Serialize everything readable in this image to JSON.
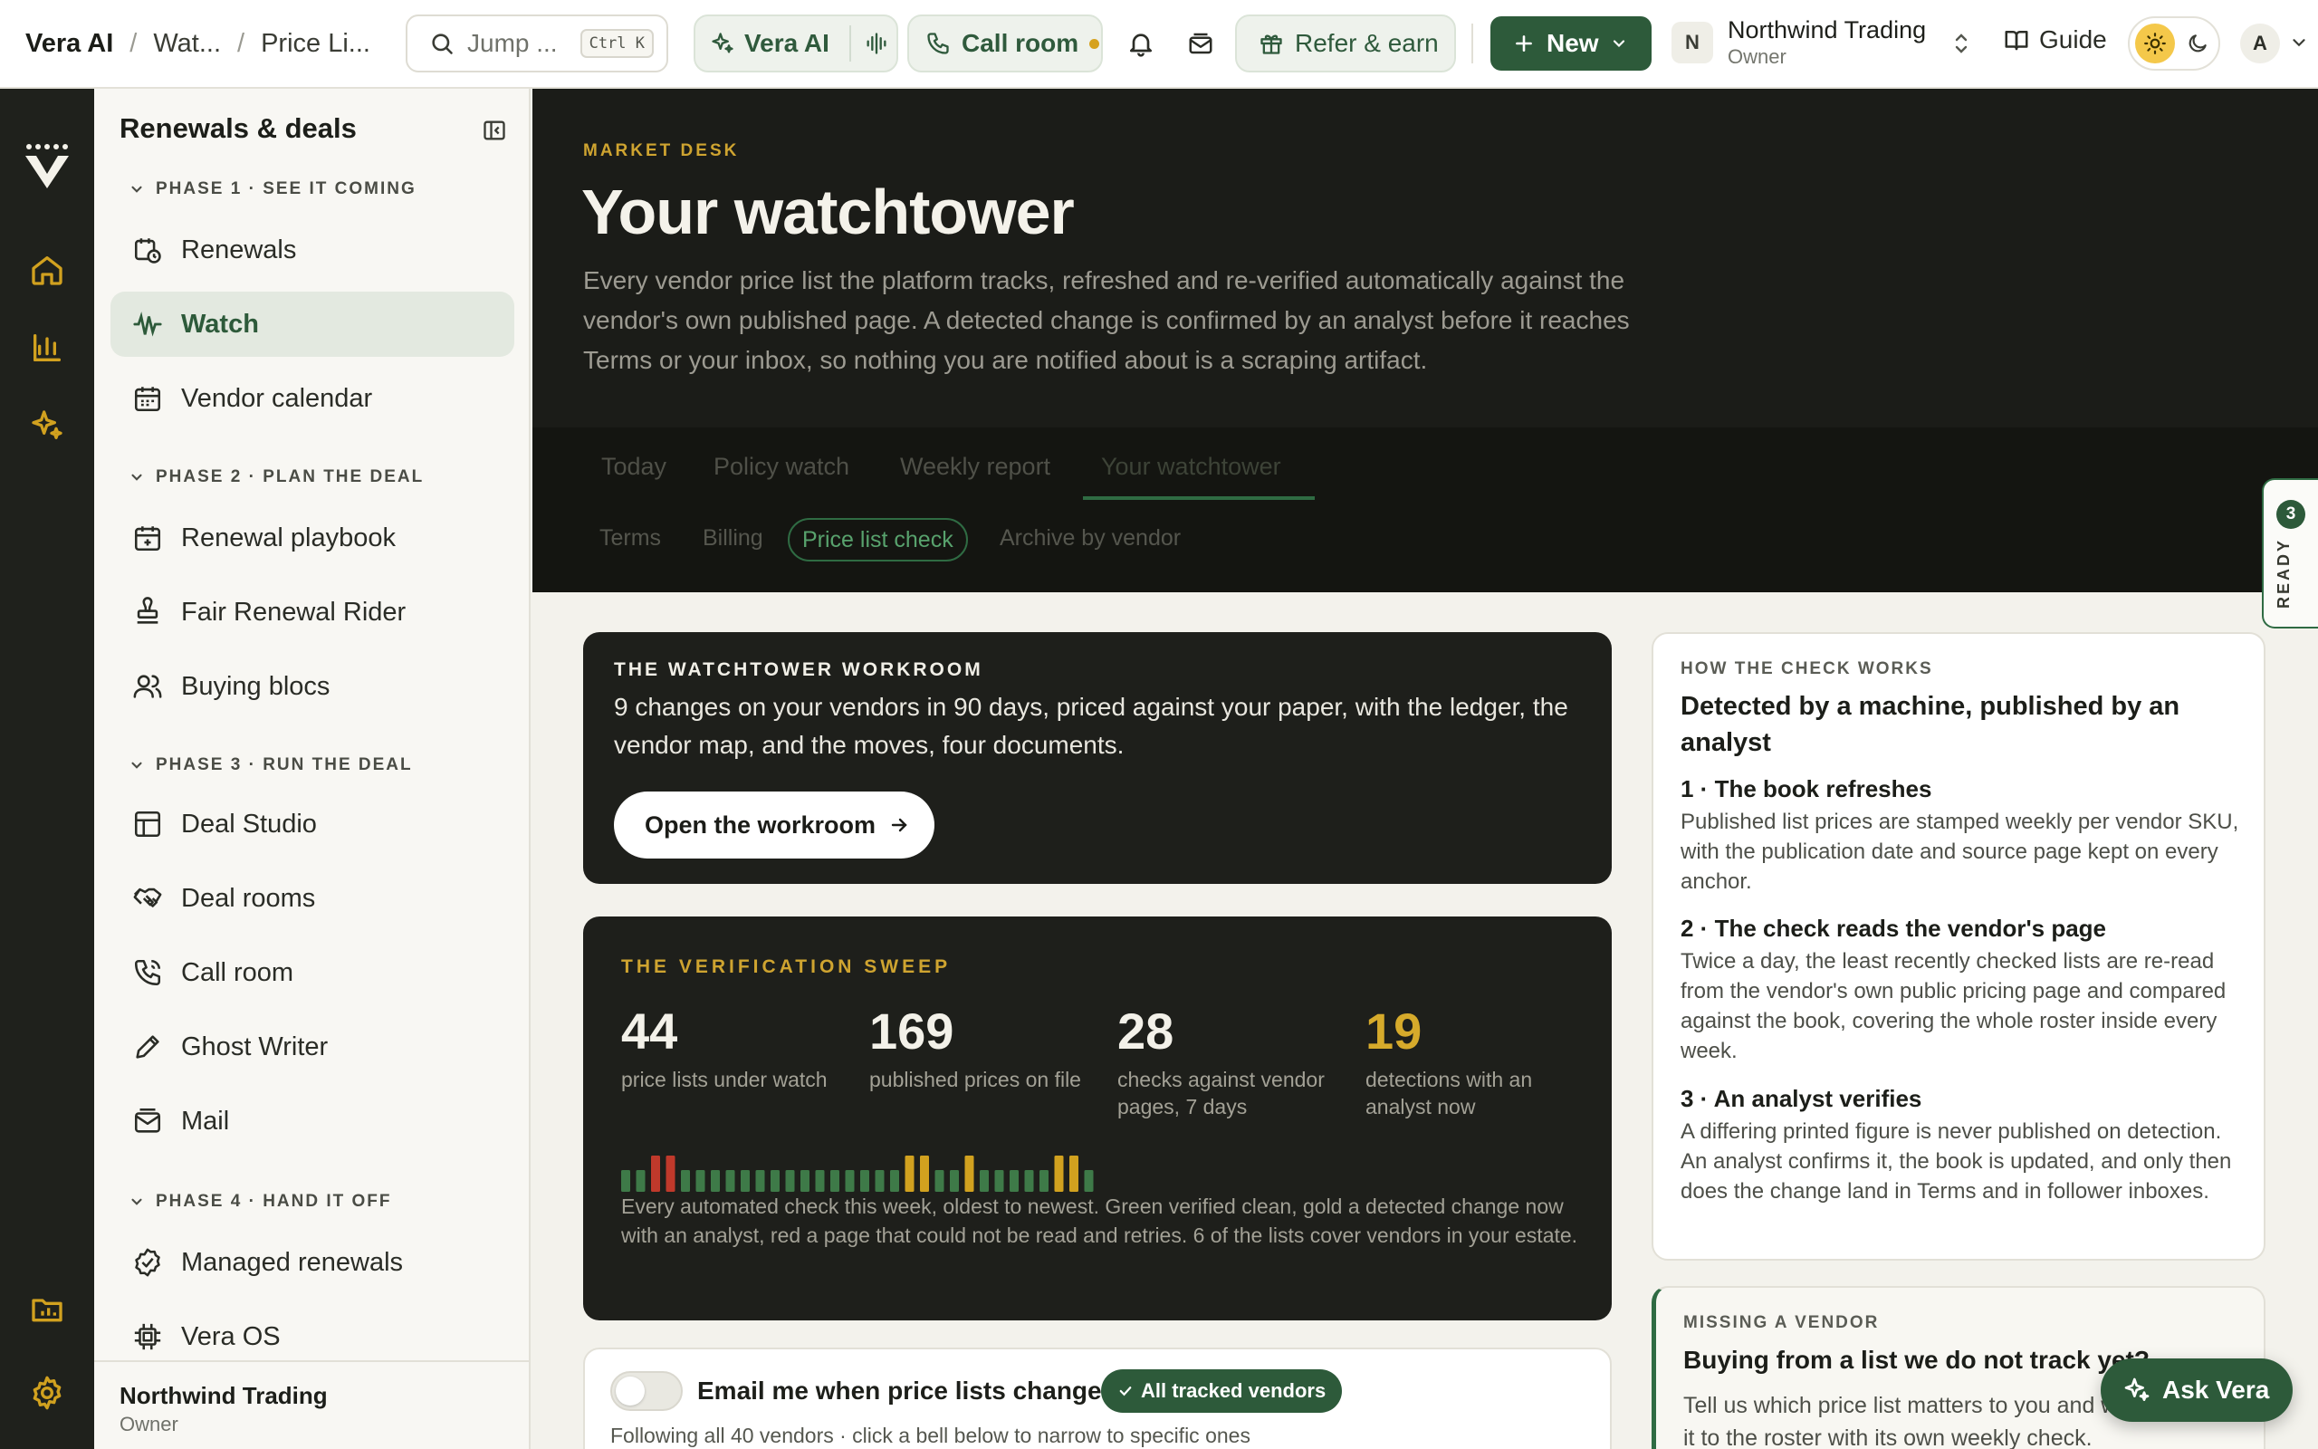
{
  "breadcrumb": [
    "Vera AI",
    "Wat...",
    "Price Li..."
  ],
  "search": {
    "label": "Jump ...",
    "shortcut": "Ctrl K"
  },
  "topbar": {
    "vera_label": "Vera AI",
    "call_label": "Call room",
    "refer_label": "Refer & earn",
    "new_label": "New",
    "org_initial": "N",
    "org_name": "Northwind Trading",
    "org_role": "Owner",
    "guide_label": "Guide",
    "avatar_initial": "A"
  },
  "sidebar": {
    "title": "Renewals & deals",
    "phases": [
      {
        "label": "PHASE 1 · SEE IT COMING",
        "items": [
          "Renewals",
          "Watch",
          "Vendor calendar"
        ]
      },
      {
        "label": "PHASE 2 · PLAN THE DEAL",
        "items": [
          "Renewal playbook",
          "Fair Renewal Rider",
          "Buying blocs"
        ]
      },
      {
        "label": "PHASE 3 · RUN THE DEAL",
        "items": [
          "Deal Studio",
          "Deal rooms",
          "Call room",
          "Ghost Writer",
          "Mail"
        ]
      },
      {
        "label": "PHASE 4 · HAND IT OFF",
        "items": [
          "Managed renewals",
          "Vera OS"
        ]
      }
    ],
    "active_item": "Watch",
    "footer_name": "Northwind Trading",
    "footer_role": "Owner"
  },
  "hero": {
    "eyebrow": "MARKET DESK",
    "title": "Your watchtower",
    "description": "Every vendor price list the platform tracks, refreshed and re-verified automatically against the vendor's own published page. A detected change is confirmed by an analyst before it reaches Terms or your inbox, so nothing you are notified about is a scraping artifact."
  },
  "tabs": [
    "Today",
    "Policy watch",
    "Weekly report",
    "Your watchtower"
  ],
  "active_tab": "Your watchtower",
  "subtabs": [
    "Terms",
    "Billing",
    "Price list check",
    "Archive by vendor"
  ],
  "active_subtab": "Price list check",
  "ready_panel": {
    "count": "3",
    "label": "READY"
  },
  "workroom": {
    "title": "THE WATCHTOWER WORKROOM",
    "description": "9 changes on your vendors in 90 days, priced against your paper, with the ledger, the vendor map, and the moves, four documents.",
    "button": "Open the workroom"
  },
  "sweep": {
    "title": "THE VERIFICATION SWEEP",
    "stats": [
      {
        "value": "44",
        "label": "price lists under watch"
      },
      {
        "value": "169",
        "label": "published prices on file"
      },
      {
        "value": "28",
        "label": "checks against vendor pages, 7 days"
      },
      {
        "value": "19",
        "label": "detections with an analyst now"
      }
    ],
    "checks": [
      "green",
      "green",
      "red",
      "red",
      "green",
      "green",
      "green",
      "green",
      "green",
      "green",
      "green",
      "green",
      "green",
      "green",
      "green",
      "green",
      "green",
      "green",
      "green",
      "gold",
      "gold",
      "green",
      "green",
      "gold",
      "green",
      "green",
      "green",
      "green",
      "green",
      "gold",
      "gold",
      "green"
    ],
    "check_colors": {
      "green": "#3e7a48",
      "gold": "#d1a11f",
      "red": "#c0392b"
    },
    "caption": "Every automated check this week, oldest to newest. Green verified clean, gold a detected change now with an analyst, red a page that could not be read and retries. 6 of the lists cover vendors in your estate."
  },
  "email_card": {
    "label": "Email me when price lists change",
    "chip": "All tracked vendors",
    "sub": "Following all 40 vendors · click a bell below to narrow to specific ones"
  },
  "how": {
    "eyebrow": "HOW THE CHECK WORKS",
    "heading": "Detected by a machine, published by an analyst",
    "steps": [
      {
        "title": "1 · The book refreshes",
        "desc": "Published list prices are stamped weekly per vendor SKU, with the publication date and source page kept on every anchor."
      },
      {
        "title": "2 · The check reads the vendor's page",
        "desc": "Twice a day, the least recently checked lists are re-read from the vendor's own public pricing page and compared against the book, covering the whole roster inside every week."
      },
      {
        "title": "3 · An analyst verifies",
        "desc": "A differing printed figure is never published on detection. An analyst confirms it, the book is updated, and only then does the change land in Terms and in follower inboxes."
      }
    ]
  },
  "missing": {
    "eyebrow": "MISSING A VENDOR",
    "heading": "Buying from a list we do not track yet?",
    "desc": "Tell us which price list matters to you and we add it to the roster with its own weekly check."
  },
  "ask_button": "Ask Vera"
}
